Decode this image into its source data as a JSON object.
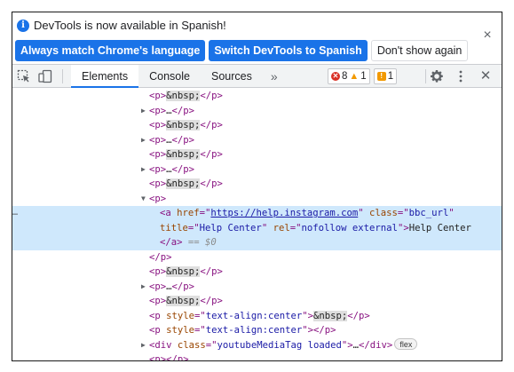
{
  "infobar": {
    "icon": "info-icon",
    "message": "DevTools is now available in Spanish!",
    "buttons": {
      "match": "Always match Chrome's language",
      "switch": "Switch DevTools to Spanish",
      "dismiss": "Don't show again"
    },
    "close": "×"
  },
  "toolbar": {
    "icons": [
      "inspect-element-icon",
      "device-toggle-icon",
      "settings-gear-icon",
      "kebab-menu-icon",
      "close-icon"
    ],
    "tabs": [
      "Elements",
      "Console",
      "Sources"
    ],
    "active_tab": "Elements",
    "more": "»",
    "errors": "8",
    "warnings": "1",
    "issues": "1",
    "close": "✕"
  },
  "colors": {
    "accent": "#1a73e8",
    "tag": "#881280",
    "attr_name": "#994500",
    "attr_value": "#1a1aa6",
    "selected_row": "#cfe8fc",
    "error": "#d93025",
    "warning": "#f29900"
  },
  "dom": {
    "p_open": "<p>",
    "p_close": "</p>",
    "nbsp": "&nbsp;",
    "ellipsis": "…",
    "gutter_dots": "…",
    "a_open": "<a ",
    "a_close": "</a>",
    "href_attr": "href",
    "href_value": "https://help.instagram.com",
    "class_attr": "class",
    "class_value": "bbc_url",
    "title_attr": "title",
    "title_value": "Help Center",
    "rel_attr": "rel",
    "rel_value": "nofollow external",
    "link_text": "Help Center",
    "selected_marker": "== $0",
    "p_style_open": "<p ",
    "style_attr": "style",
    "style_value": "text-align:center",
    "div_open": "<div ",
    "div_class_value": "youtubeMediaTag loaded",
    "div_close": "</div>",
    "flex_badge": "flex"
  }
}
